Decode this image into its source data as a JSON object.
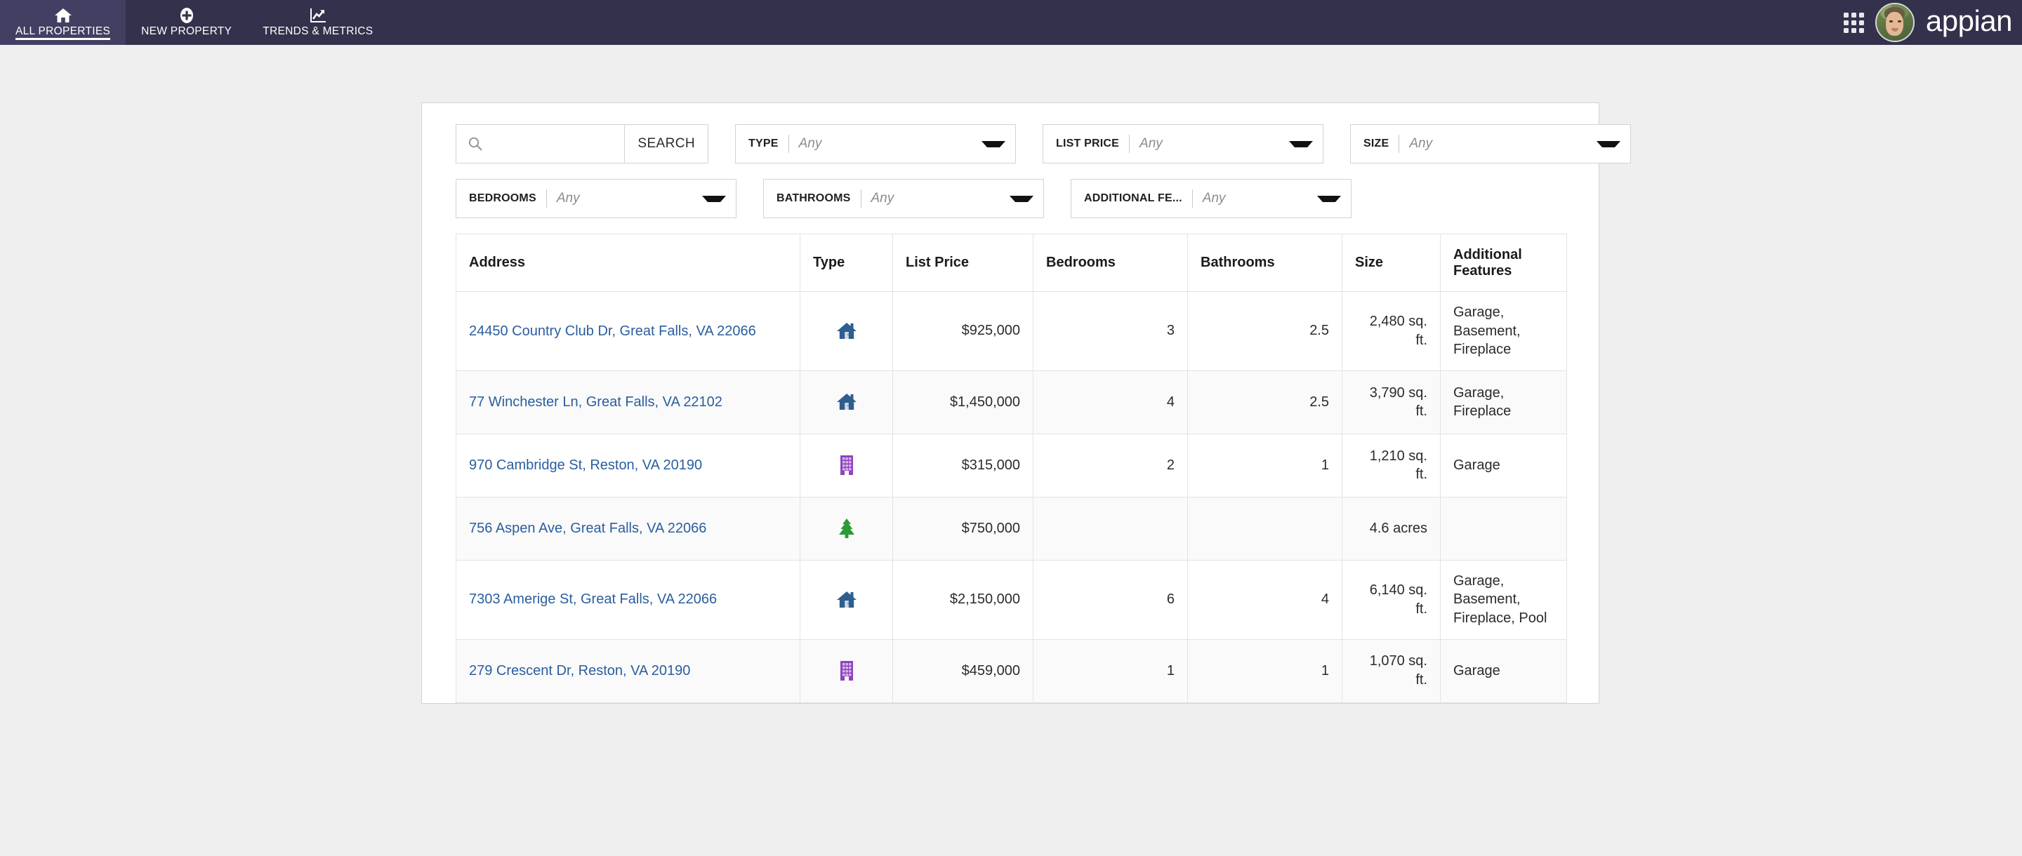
{
  "nav": {
    "tabs": [
      {
        "label": "ALL PROPERTIES",
        "icon": "home-icon",
        "active": true
      },
      {
        "label": "NEW PROPERTY",
        "icon": "plus-circle-icon",
        "active": false
      },
      {
        "label": "TRENDS & METRICS",
        "icon": "chart-line-icon",
        "active": false
      }
    ],
    "apps_icon": "grid-apps-icon",
    "avatar": "user-avatar",
    "brand": "appian",
    "brand_color": "#ffffff",
    "bar_color": "#34314c",
    "active_tab_color": "#433f63"
  },
  "filters": {
    "search": {
      "icon": "search-icon",
      "value": "",
      "placeholder": "",
      "button_label": "SEARCH"
    },
    "dropdowns": [
      {
        "label": "TYPE",
        "value": "Any",
        "name": "type"
      },
      {
        "label": "LIST PRICE",
        "value": "Any",
        "name": "list-price"
      },
      {
        "label": "SIZE",
        "value": "Any",
        "name": "size"
      },
      {
        "label": "BEDROOMS",
        "value": "Any",
        "name": "bedrooms"
      },
      {
        "label": "BATHROOMS",
        "value": "Any",
        "name": "bathrooms"
      },
      {
        "label": "ADDITIONAL FE...",
        "value": "Any",
        "name": "additional-features"
      }
    ]
  },
  "table": {
    "columns": [
      "Address",
      "Type",
      "List Price",
      "Bedrooms",
      "Bathrooms",
      "Size",
      "Additional Features"
    ],
    "rows": [
      {
        "address": "24450 Country Club Dr, Great Falls, VA 22066",
        "type_icon": "house-icon",
        "type_color": "#2d5e8e",
        "list_price": "$925,000",
        "bedrooms": "3",
        "bathrooms": "2.5",
        "size": "2,480 sq. ft.",
        "features": "Garage, Basement, Fireplace"
      },
      {
        "address": "77 Winchester Ln, Great Falls, VA 22102",
        "type_icon": "house-icon",
        "type_color": "#2d5e8e",
        "list_price": "$1,450,000",
        "bedrooms": "4",
        "bathrooms": "2.5",
        "size": "3,790 sq. ft.",
        "features": "Garage, Fireplace"
      },
      {
        "address": "970 Cambridge St, Reston, VA 20190",
        "type_icon": "building-icon",
        "type_color": "#8e44c0",
        "list_price": "$315,000",
        "bedrooms": "2",
        "bathrooms": "1",
        "size": "1,210 sq. ft.",
        "features": "Garage"
      },
      {
        "address": "756 Aspen Ave, Great Falls, VA 22066",
        "type_icon": "tree-icon",
        "type_color": "#2e9937",
        "list_price": "$750,000",
        "bedrooms": "",
        "bathrooms": "",
        "size": "4.6 acres",
        "features": ""
      },
      {
        "address": "7303 Amerige St, Great Falls, VA 22066",
        "type_icon": "house-icon",
        "type_color": "#2d5e8e",
        "list_price": "$2,150,000",
        "bedrooms": "6",
        "bathrooms": "4",
        "size": "6,140 sq. ft.",
        "features": "Garage, Basement, Fireplace, Pool"
      },
      {
        "address": "279 Crescent Dr, Reston, VA 20190",
        "type_icon": "building-icon",
        "type_color": "#8e44c0",
        "list_price": "$459,000",
        "bedrooms": "1",
        "bathrooms": "1",
        "size": "1,070 sq. ft.",
        "features": "Garage"
      }
    ]
  }
}
